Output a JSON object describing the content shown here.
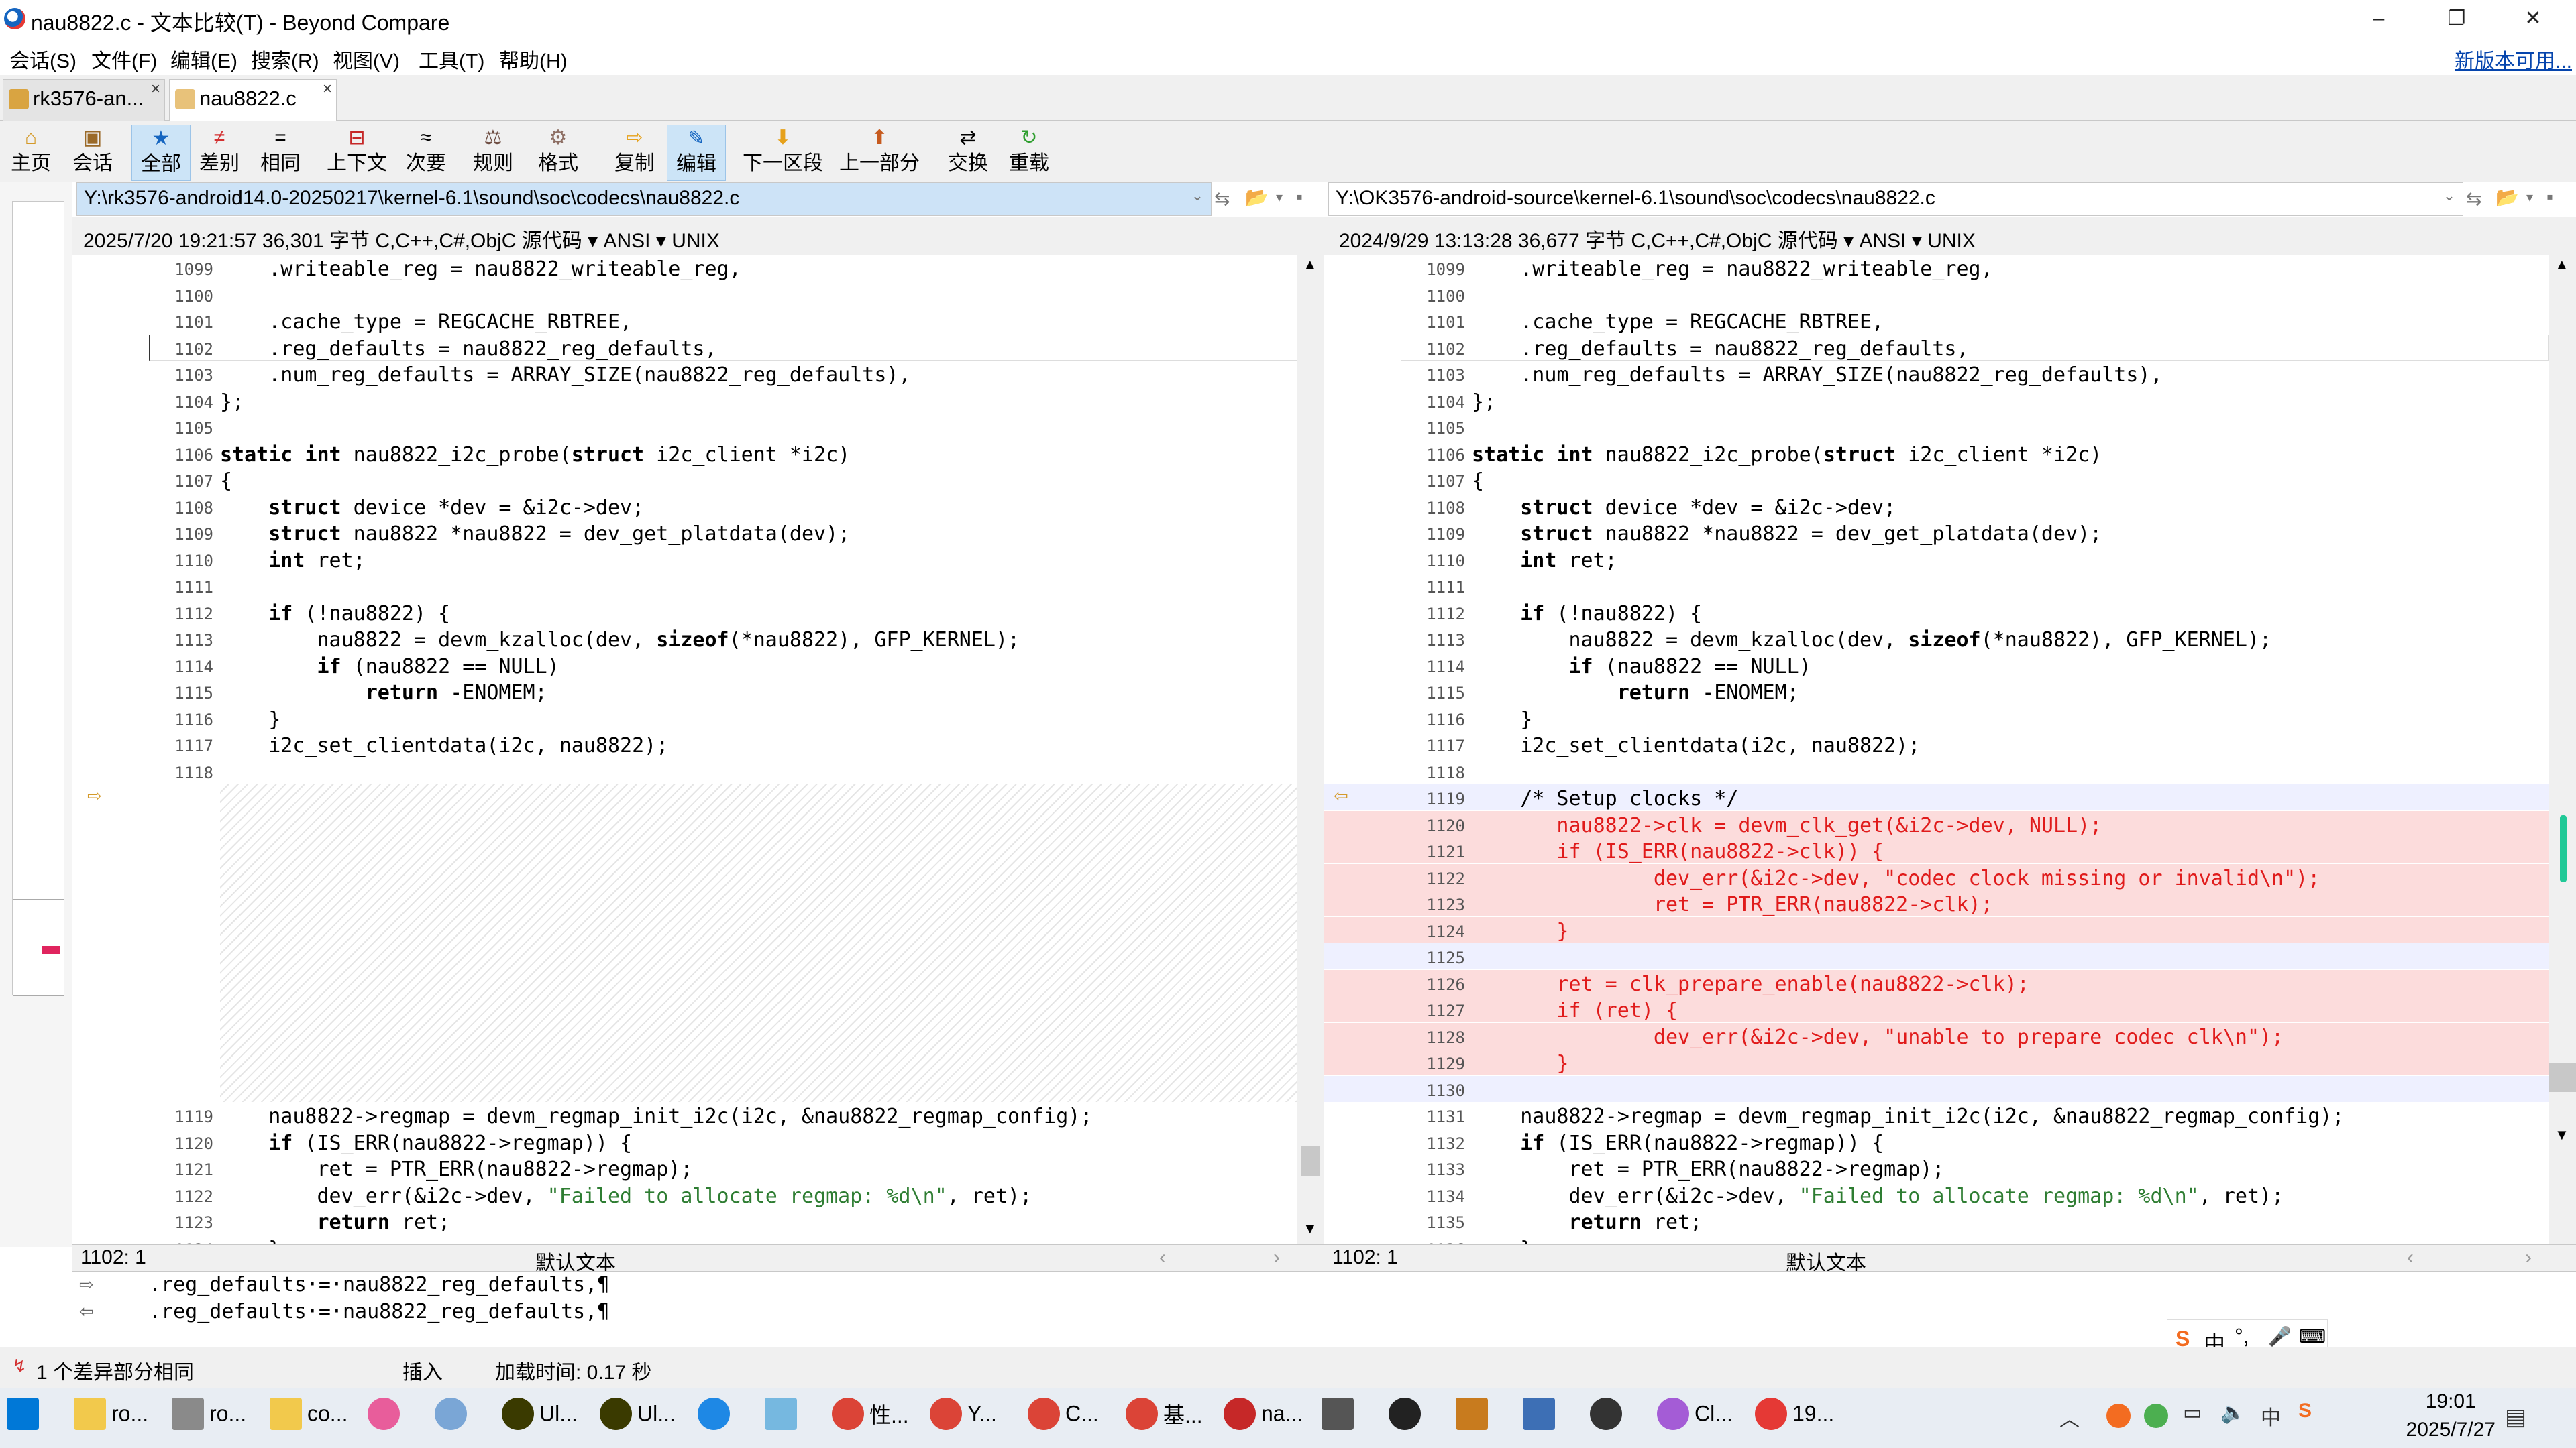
{
  "window": {
    "title": "nau8822.c - 文本比较(T) - Beyond Compare",
    "minimize": "–",
    "maximize": "❐",
    "close": "✕"
  },
  "menu": [
    "会话(S)",
    "文件(F)",
    "编辑(E)",
    "搜索(R)",
    "视图(V)",
    "工具(T)",
    "帮助(H)"
  ],
  "new_version": "新版本可用...",
  "tabs": [
    {
      "label": "rk3576-an...",
      "active": false
    },
    {
      "label": "nau8822.c",
      "active": true
    }
  ],
  "toolbar": [
    {
      "label": "主页",
      "icon": "home-icon",
      "glyph": "⌂",
      "selected": false
    },
    {
      "label": "会话",
      "icon": "briefcase-icon",
      "glyph": "▣",
      "selected": false
    },
    {
      "label": "全部",
      "icon": "star-icon",
      "glyph": "★",
      "selected": true
    },
    {
      "label": "差别",
      "icon": "diff-icon",
      "glyph": "≠",
      "selected": false
    },
    {
      "label": "相同",
      "icon": "equal-icon",
      "glyph": "=",
      "selected": false
    },
    {
      "label": "上下文",
      "icon": "context-icon",
      "glyph": "⊟",
      "selected": false
    },
    {
      "label": "次要",
      "icon": "minor-icon",
      "glyph": "≈",
      "selected": false
    },
    {
      "label": "规则",
      "icon": "rules-icon",
      "glyph": "⚖",
      "selected": false
    },
    {
      "label": "格式",
      "icon": "format-icon",
      "glyph": "⚙",
      "selected": false
    },
    {
      "label": "复制",
      "icon": "copy-arrow-icon",
      "glyph": "⇨",
      "selected": false
    },
    {
      "label": "编辑",
      "icon": "edit-icon",
      "glyph": "✎",
      "selected": true
    },
    {
      "label": "下一区段",
      "icon": "next-section-icon",
      "glyph": "⬇",
      "selected": false
    },
    {
      "label": "上一部分",
      "icon": "prev-section-icon",
      "glyph": "⬆",
      "selected": false
    },
    {
      "label": "交换",
      "icon": "swap-icon",
      "glyph": "⇄",
      "selected": false
    },
    {
      "label": "重载",
      "icon": "reload-icon",
      "glyph": "↻",
      "selected": false
    }
  ],
  "left": {
    "path": "Y:\\rk3576-android14.0-20250217\\kernel-6.1\\sound\\soc\\codecs\\nau8822.c",
    "info": "2025/7/20 19:21:57  36,301 字节  C,C++,C#,ObjC 源代码 ▾ ANSI ▾ UNIX",
    "position": "1102: 1",
    "format": "默认文本"
  },
  "right": {
    "path": "Y:\\OK3576-android-source\\kernel-6.1\\sound\\soc\\codecs\\nau8822.c",
    "info": "2024/9/29 13:13:28  36,677 字节  C,C++,C#,ObjC 源代码 ▾ ANSI ▾ UNIX",
    "position": "1102: 1",
    "format": "默认文本"
  },
  "left_lines": [
    {
      "n": "1099",
      "t": "    .writeable_reg = nau8822_writeable_reg,"
    },
    {
      "n": "1100",
      "t": ""
    },
    {
      "n": "1101",
      "t": "    .cache_type = REGCACHE_RBTREE,"
    },
    {
      "n": "1102",
      "t": "    .reg_defaults = nau8822_reg_defaults,"
    },
    {
      "n": "1103",
      "t": "    .num_reg_defaults = ARRAY_SIZE(nau8822_reg_defaults),"
    },
    {
      "n": "1104",
      "t": "};"
    },
    {
      "n": "1105",
      "t": ""
    },
    {
      "n": "1106",
      "t": "static int nau8822_i2c_probe(struct i2c_client *i2c)"
    },
    {
      "n": "1107",
      "t": "{"
    },
    {
      "n": "1108",
      "t": "    struct device *dev = &i2c->dev;"
    },
    {
      "n": "1109",
      "t": "    struct nau8822 *nau8822 = dev_get_platdata(dev);"
    },
    {
      "n": "1110",
      "t": "    int ret;"
    },
    {
      "n": "1111",
      "t": ""
    },
    {
      "n": "1112",
      "t": "    if (!nau8822) {"
    },
    {
      "n": "1113",
      "t": "        nau8822 = devm_kzalloc(dev, sizeof(*nau8822), GFP_KERNEL);"
    },
    {
      "n": "1114",
      "t": "        if (nau8822 == NULL)"
    },
    {
      "n": "1115",
      "t": "            return -ENOMEM;"
    },
    {
      "n": "1116",
      "t": "    }"
    },
    {
      "n": "1117",
      "t": "    i2c_set_clientdata(i2c, nau8822);"
    },
    {
      "n": "1118",
      "t": ""
    }
  ],
  "left_lines_after": [
    {
      "n": "1119",
      "t": "    nau8822->regmap = devm_regmap_init_i2c(i2c, &nau8822_regmap_config);"
    },
    {
      "n": "1120",
      "t": "    if (IS_ERR(nau8822->regmap)) {"
    },
    {
      "n": "1121",
      "t": "        ret = PTR_ERR(nau8822->regmap);"
    },
    {
      "n": "1122",
      "t": "        dev_err(&i2c->dev, \"Failed to allocate regmap: %d\\n\", ret);"
    },
    {
      "n": "1123",
      "t": "        return ret;"
    },
    {
      "n": "1124",
      "t": "    }"
    }
  ],
  "right_lines": [
    {
      "n": "1099",
      "t": "    .writeable_reg = nau8822_writeable_reg,",
      "k": ""
    },
    {
      "n": "1100",
      "t": "",
      "k": ""
    },
    {
      "n": "1101",
      "t": "    .cache_type = REGCACHE_RBTREE,",
      "k": ""
    },
    {
      "n": "1102",
      "t": "    .reg_defaults = nau8822_reg_defaults,",
      "k": ""
    },
    {
      "n": "1103",
      "t": "    .num_reg_defaults = ARRAY_SIZE(nau8822_reg_defaults),",
      "k": ""
    },
    {
      "n": "1104",
      "t": "};",
      "k": ""
    },
    {
      "n": "1105",
      "t": "",
      "k": ""
    },
    {
      "n": "1106",
      "t": "static int nau8822_i2c_probe(struct i2c_client *i2c)",
      "k": ""
    },
    {
      "n": "1107",
      "t": "{",
      "k": ""
    },
    {
      "n": "1108",
      "t": "    struct device *dev = &i2c->dev;",
      "k": ""
    },
    {
      "n": "1109",
      "t": "    struct nau8822 *nau8822 = dev_get_platdata(dev);",
      "k": ""
    },
    {
      "n": "1110",
      "t": "    int ret;",
      "k": ""
    },
    {
      "n": "1111",
      "t": "",
      "k": ""
    },
    {
      "n": "1112",
      "t": "    if (!nau8822) {",
      "k": ""
    },
    {
      "n": "1113",
      "t": "        nau8822 = devm_kzalloc(dev, sizeof(*nau8822), GFP_KERNEL);",
      "k": ""
    },
    {
      "n": "1114",
      "t": "        if (nau8822 == NULL)",
      "k": ""
    },
    {
      "n": "1115",
      "t": "            return -ENOMEM;",
      "k": ""
    },
    {
      "n": "1116",
      "t": "    }",
      "k": ""
    },
    {
      "n": "1117",
      "t": "    i2c_set_clientdata(i2c, nau8822);",
      "k": ""
    },
    {
      "n": "1118",
      "t": "",
      "k": ""
    },
    {
      "n": "1119",
      "t": "    /* Setup clocks */",
      "k": "cm"
    },
    {
      "n": "1120",
      "t": "       nau8822->clk = devm_clk_get(&i2c->dev, NULL);",
      "k": "diff"
    },
    {
      "n": "1121",
      "t": "       if (IS_ERR(nau8822->clk)) {",
      "k": "diff"
    },
    {
      "n": "1122",
      "t": "               dev_err(&i2c->dev, \"codec clock missing or invalid\\n\");",
      "k": "diff"
    },
    {
      "n": "1123",
      "t": "               ret = PTR_ERR(nau8822->clk);",
      "k": "diff"
    },
    {
      "n": "1124",
      "t": "       }",
      "k": "diff"
    },
    {
      "n": "1125",
      "t": "",
      "k": "blank"
    },
    {
      "n": "1126",
      "t": "       ret = clk_prepare_enable(nau8822->clk);",
      "k": "diff"
    },
    {
      "n": "1127",
      "t": "       if (ret) {",
      "k": "diff"
    },
    {
      "n": "1128",
      "t": "               dev_err(&i2c->dev, \"unable to prepare codec clk\\n\");",
      "k": "diff"
    },
    {
      "n": "1129",
      "t": "       }",
      "k": "diff"
    },
    {
      "n": "1130",
      "t": "",
      "k": "blank"
    },
    {
      "n": "1131",
      "t": "    nau8822->regmap = devm_regmap_init_i2c(i2c, &nau8822_regmap_config);",
      "k": ""
    },
    {
      "n": "1132",
      "t": "    if (IS_ERR(nau8822->regmap)) {",
      "k": ""
    },
    {
      "n": "1133",
      "t": "        ret = PTR_ERR(nau8822->regmap);",
      "k": ""
    },
    {
      "n": "1134",
      "t": "        dev_err(&i2c->dev, \"Failed to allocate regmap: %d\\n\", ret);",
      "k": ""
    },
    {
      "n": "1135",
      "t": "        return ret;",
      "k": ""
    },
    {
      "n": "1136",
      "t": "    }",
      "k": ""
    }
  ],
  "compare": {
    "line1": ".reg_defaults·=·nau8822_reg_defaults,¶",
    "line2": ".reg_defaults·=·nau8822_reg_defaults,¶"
  },
  "status": {
    "diffs": "1 个差异部分相同",
    "mode": "插入",
    "load": "加载时间: 0.17 秒"
  },
  "ime": {
    "brand": "S",
    "mode": "中",
    "punct": "°,"
  },
  "taskbar": [
    {
      "label": "",
      "icon": "windows-start-icon",
      "color": "#0078d7"
    },
    {
      "label": "ro...",
      "icon": "folder-icon",
      "color": "#f2c94c"
    },
    {
      "label": "ro...",
      "icon": "drive-icon",
      "color": "#8a8a8a"
    },
    {
      "label": "co...",
      "icon": "folder-icon",
      "color": "#f2c94c"
    },
    {
      "label": "",
      "icon": "pinwheel-icon",
      "color": "#e85d9b"
    },
    {
      "label": "",
      "icon": "pen-icon",
      "color": "#7aa6d6"
    },
    {
      "label": "Ul...",
      "icon": "ultraedit-icon",
      "color": "#3a3a00"
    },
    {
      "label": "Ul...",
      "icon": "ultraedit-icon",
      "color": "#3a3a00"
    },
    {
      "label": "",
      "icon": "edge-icon",
      "color": "#1e88e5"
    },
    {
      "label": "",
      "icon": "notepad-icon",
      "color": "#76b8e0"
    },
    {
      "label": "性...",
      "icon": "chrome-icon",
      "color": "#db4437"
    },
    {
      "label": "Y...",
      "icon": "chrome-icon",
      "color": "#db4437"
    },
    {
      "label": "C...",
      "icon": "chrome-icon",
      "color": "#db4437"
    },
    {
      "label": "基...",
      "icon": "chrome-icon",
      "color": "#db4437"
    },
    {
      "label": "na...",
      "icon": "beyond-compare-icon",
      "color": "#c62828"
    },
    {
      "label": "",
      "icon": "se-icon",
      "color": "#555555"
    },
    {
      "label": "",
      "icon": "audio-icon",
      "color": "#222222"
    },
    {
      "label": "",
      "icon": "chart-app-icon",
      "color": "#c87b1e"
    },
    {
      "label": "",
      "icon": "config-icon",
      "color": "#3d6fb5"
    },
    {
      "label": "",
      "icon": "gear-app-icon",
      "color": "#333333"
    },
    {
      "label": "Cl...",
      "icon": "cat-icon",
      "color": "#a45cd6"
    },
    {
      "label": "19...",
      "icon": "swirl-icon",
      "color": "#e53935"
    }
  ],
  "clock": {
    "time": "19:01",
    "date": "2025/7/27"
  }
}
